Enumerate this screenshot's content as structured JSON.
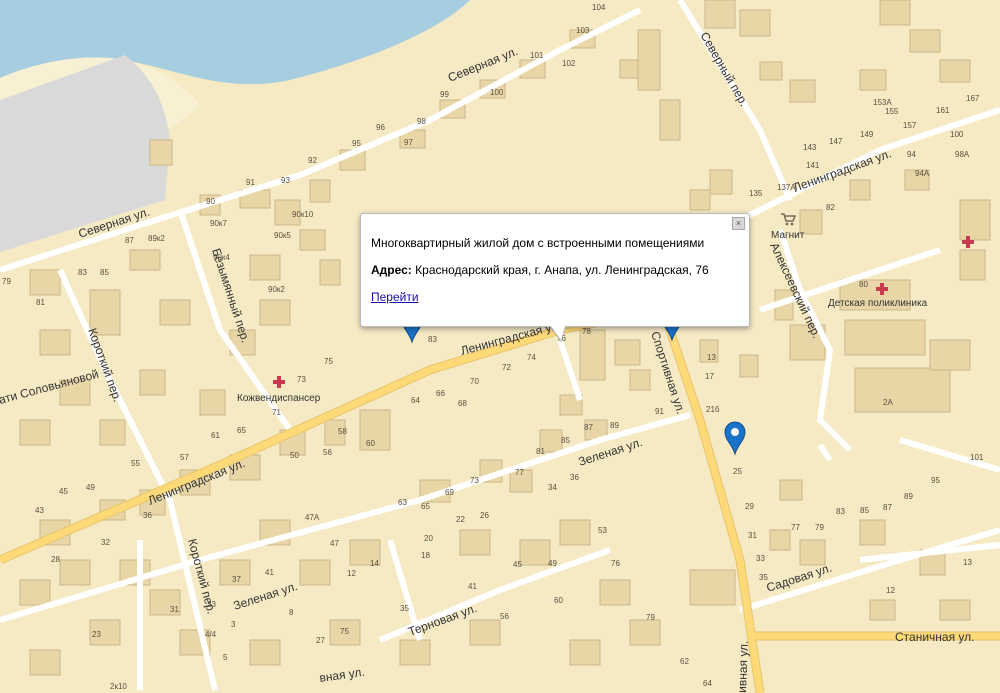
{
  "popup": {
    "title": "Многоквартирный жилой дом с встроенными помещениями",
    "address_label": "Адрес:",
    "address_value": "Краснодарский края, г. Анапа, ул. Ленинградская, 76",
    "link_label": "Перейти",
    "close_icon": "close-icon"
  },
  "streets": {
    "severnaya_1": "Северная ул.",
    "severnaya_2": "Северная ул.",
    "severny_per": "Северный пер.",
    "leningradskaya_1": "Ленинградская ул.",
    "leningradskaya_2": "Ленинградская ул.",
    "leningradskaya_3": "Ленинградская ул.",
    "sportivnaya_1": "Спортивная ул.",
    "sportivnaya_2": "ивная ул.",
    "sportivnaya_3": "вная ул.",
    "zelenaya_1": "Зеленая ул.",
    "zelenaya_2": "Зеленая ул.",
    "ternovaya": "Терновая ул.",
    "sadovaya": "Садовая ул.",
    "stanichnaya": "Станичная ул.",
    "alekseevsky": "Алексеевский пер.",
    "bezymyanny": "Безымянный пер.",
    "korotky_1": "Короткий пер.",
    "korotky_2": "Короткий пер.",
    "solovyanova": "ати Соловьяновой"
  },
  "pois": {
    "magnit": "Магнит",
    "detskaya": "Детская поликлиника",
    "kozhven": "Кожвендиспансер"
  },
  "house_numbers": {
    "n104": "104",
    "n103": "103",
    "n101": "101",
    "n102": "102",
    "n99": "99",
    "n100": "100",
    "n96": "96",
    "n98": "98",
    "n95": "95",
    "n97": "97",
    "n92": "92",
    "n91": "91",
    "n93": "93",
    "n90": "90",
    "n90k7": "90к7",
    "n90k10": "90к10",
    "n90k5": "90к5",
    "n90k4": "90к4",
    "n90k2": "90к2",
    "n87": "87",
    "n89k2": "89к2",
    "n83": "83",
    "n79": "79",
    "n81": "81",
    "n83b": "83",
    "n85": "85",
    "n75": "75",
    "n73": "73",
    "n71": "71",
    "n78": "78",
    "n76": "76",
    "n74": "74",
    "n72": "72",
    "n70": "70",
    "n66": "66",
    "n64": "64",
    "n68": "68",
    "n61": "61",
    "n65": "65",
    "n57": "57",
    "n58": "58",
    "n60": "60",
    "n56": "56",
    "n50": "50",
    "n55": "55",
    "n49": "49",
    "n45": "45",
    "n43": "43",
    "n36": "36",
    "n32": "32",
    "n28": "28",
    "n37": "37",
    "n41": "41",
    "n31": "31",
    "n33": "33",
    "n23": "23",
    "n4_4": "4/4",
    "n3": "3",
    "n8": "8",
    "n5": "5",
    "n2x10": "2к10",
    "n47a": "47А",
    "n47": "47",
    "n63": "63",
    "n65b": "65",
    "n69": "69",
    "n73b": "73",
    "n77": "77",
    "n81b": "81",
    "n85b": "85",
    "n87b": "87",
    "n89": "89",
    "n34": "34",
    "n36b": "36",
    "n22": "22",
    "n26": "26",
    "n20": "20",
    "n18": "18",
    "n14": "14",
    "n12": "12",
    "n75b": "75",
    "n45b": "45",
    "n49b": "49",
    "n53": "53",
    "n76b": "76",
    "n41b": "41",
    "n35": "35",
    "n27": "27",
    "n56b": "56",
    "n60b": "60",
    "n79b": "79",
    "n62": "62",
    "n64b": "64",
    "n13": "13",
    "n17": "17",
    "n21b": "21б",
    "n25": "25",
    "n29": "29",
    "n31b": "31",
    "n33b": "33",
    "n35b": "35",
    "n153a": "153А",
    "n167": "167",
    "n161": "161",
    "n157": "157",
    "n155": "155",
    "n149": "149",
    "n147": "147",
    "n143": "143",
    "n141": "141",
    "n137a": "137А",
    "n135": "135",
    "n100b": "100",
    "n98a": "98А",
    "n94": "94",
    "n94a": "94А",
    "n82": "82",
    "n80": "80",
    "n2a": "2А",
    "n101b": "101",
    "n95b": "95",
    "n89c": "89",
    "n87c": "87",
    "n85c": "85",
    "n83c": "83",
    "n79c": "79",
    "n77c": "77",
    "n13b": "13",
    "n12b": "12"
  },
  "colors": {
    "land": "#f6eac4",
    "water": "#a7cde0",
    "industrial": "#d7d7d7",
    "beach": "#f7f0d2",
    "building": "#e8d6a7",
    "building_shade": "#cbb789",
    "road": "#ffffff",
    "main_road": "#fdd978",
    "pin": "#1a73c9"
  }
}
